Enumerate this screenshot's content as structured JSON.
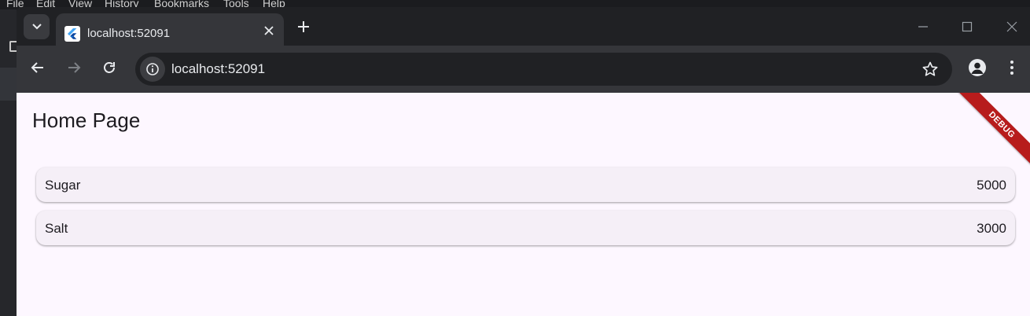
{
  "background_app": {
    "menu": [
      "File",
      "Edit",
      "View",
      "History",
      "Bookmarks",
      "Tools",
      "Help"
    ]
  },
  "browser": {
    "tab": {
      "title": "localhost:52091"
    },
    "address_bar": {
      "url": "localhost:52091"
    },
    "icons": {
      "tab_search": "chevron-down-icon",
      "favicon": "flutter-logo",
      "close_tab": "close-icon",
      "new_tab": "plus-icon",
      "back": "arrow-left-icon",
      "forward": "arrow-right-icon",
      "reload": "reload-icon",
      "site_info": "info-icon",
      "bookmark": "star-icon",
      "profile": "person-icon",
      "menu": "kebab-icon",
      "minimize": "minimize-icon",
      "maximize": "maximize-icon",
      "close_window": "close-icon"
    }
  },
  "app": {
    "title": "Home Page",
    "debug_banner": "DEBUG",
    "items": [
      {
        "name": "Sugar",
        "quantity": "5000"
      },
      {
        "name": "Salt",
        "quantity": "3000"
      }
    ],
    "colors": {
      "background": "#fdf7ff",
      "card": "#f5eff7",
      "banner": "#b71c1c"
    }
  }
}
